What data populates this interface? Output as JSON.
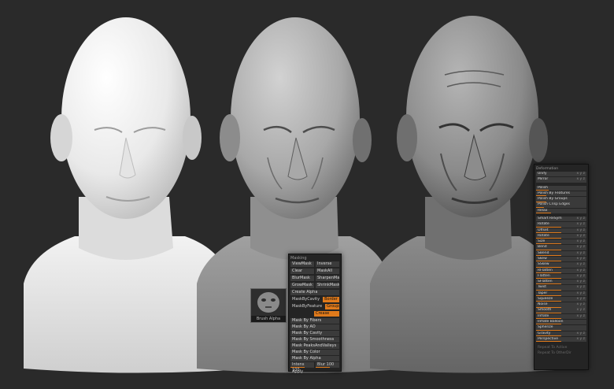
{
  "masking": {
    "title": "Masking",
    "view_mask": "ViewMask",
    "inverse": "Inverse",
    "clear": "Clear",
    "mask_all": "MaskAll",
    "blur_mask": "BlurMask",
    "sharpen_mask": "SharpenMask",
    "grow_mask": "GrowMask",
    "shrink_mask": "ShrinkMask",
    "create_alpha": "Create Alpha",
    "cavity_mask": "MaskByCavity",
    "mask_by_feature": "MaskByFeature",
    "border": "Border",
    "groups": "Groups",
    "crease": "Crease",
    "mask_by_fibers": "Mask By Fibers",
    "mask_by_ao": "Mask By AO",
    "mask_by_cavity": "Mask By Cavity",
    "mask_by_smoothness": "Mask By Smoothness",
    "mask_peaks": "Mask PeaksAndValleys",
    "mask_by_color": "Mask By Color",
    "mask_by_alpha": "Mask By Alpha",
    "intensity_label": "Intens 100",
    "blur_label": "Blur 100",
    "apply": "Apply",
    "alpha_caption": "Brush Alpha"
  },
  "deformation": {
    "title": "Deformation",
    "items": [
      {
        "label": "Unify",
        "value": 0,
        "axis": "x y z"
      },
      {
        "label": "Mirror",
        "value": 0,
        "axis": "x y z"
      },
      {
        "label": "Polish",
        "value": 0.25,
        "axis": ""
      },
      {
        "label": "Polish By Features",
        "value": 0.2,
        "axis": ""
      },
      {
        "label": "Polish By Groups",
        "value": 0.2,
        "axis": ""
      },
      {
        "label": "Polish Crisp Edges",
        "value": 0.15,
        "axis": ""
      },
      {
        "label": "Relax",
        "value": 0.3,
        "axis": ""
      },
      {
        "label": "Smart ReSym",
        "value": 0,
        "axis": "x y z"
      },
      {
        "label": "Rotate",
        "value": 0.5,
        "axis": "x y z"
      },
      {
        "label": "Offset",
        "value": 0.5,
        "axis": "x y z"
      },
      {
        "label": "Rotate",
        "value": 0.5,
        "axis": "x y z"
      },
      {
        "label": "Size",
        "value": 0.5,
        "axis": "x y z"
      },
      {
        "label": "Bend",
        "value": 0.5,
        "axis": "x y z"
      },
      {
        "label": "SBend",
        "value": 0.5,
        "axis": "x y z"
      },
      {
        "label": "Skew",
        "value": 0.5,
        "axis": "x y z"
      },
      {
        "label": "SSkew",
        "value": 0.5,
        "axis": "x y z"
      },
      {
        "label": "RFlatten",
        "value": 0.5,
        "axis": "x y z"
      },
      {
        "label": "Flatten",
        "value": 0.5,
        "axis": "x y z"
      },
      {
        "label": "SFlatten",
        "value": 0.5,
        "axis": "x y z"
      },
      {
        "label": "Twist",
        "value": 0.5,
        "axis": "x y z"
      },
      {
        "label": "Taper",
        "value": 0.5,
        "axis": "x y z"
      },
      {
        "label": "Squeeze",
        "value": 0.5,
        "axis": "x y z"
      },
      {
        "label": "Noise",
        "value": 0.5,
        "axis": "x y z"
      },
      {
        "label": "Smooth",
        "value": 0.5,
        "axis": "x y z"
      },
      {
        "label": "Inflate",
        "value": 0.5,
        "axis": "x y z"
      },
      {
        "label": "Inflate Balloon",
        "value": 0.5,
        "axis": ""
      },
      {
        "label": "Spherize",
        "value": 0.5,
        "axis": ""
      },
      {
        "label": "Gravity",
        "value": 0.5,
        "axis": "x y z"
      },
      {
        "label": "Perspective",
        "value": 0.5,
        "axis": "x y z"
      },
      {
        "label": "Repeat To Active",
        "value": 0,
        "axis": ""
      },
      {
        "label": "Repeat To Other",
        "value": 0,
        "axis": "Dir"
      }
    ]
  },
  "colors": {
    "background": "#2a2a2a",
    "panel": "#242424",
    "button": "#3b3b3b",
    "accent": "#e07a1b"
  }
}
